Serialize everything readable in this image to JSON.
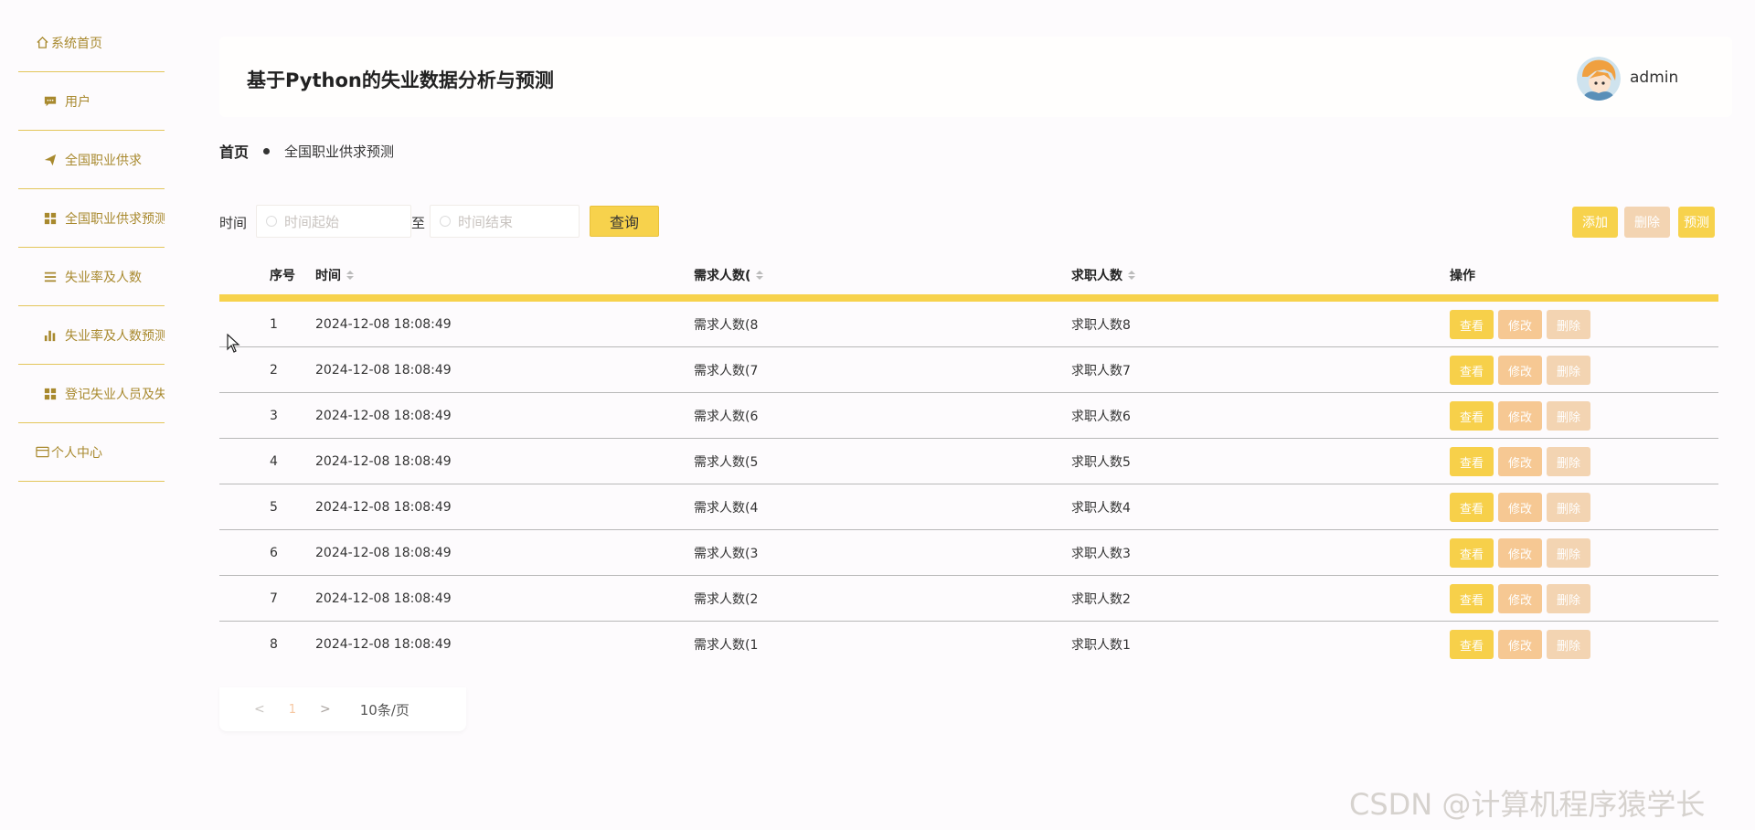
{
  "sidebar": {
    "items": [
      {
        "label": "系统首页",
        "icon": "home-icon"
      },
      {
        "label": "用户",
        "icon": "chat-icon"
      },
      {
        "label": "全国职业供求",
        "icon": "send-icon"
      },
      {
        "label": "全国职业供求预测",
        "icon": "grid-icon"
      },
      {
        "label": "失业率及人数",
        "icon": "list-icon"
      },
      {
        "label": "失业率及人数预测",
        "icon": "bar-chart-icon"
      },
      {
        "label": "登记失业人员及失业率",
        "icon": "grid-icon"
      },
      {
        "label": "个人中心",
        "icon": "card-icon"
      }
    ]
  },
  "header": {
    "title": "基于Python的失业数据分析与预测",
    "user": "admin"
  },
  "breadcrumb": {
    "home": "首页",
    "current": "全国职业供求预测"
  },
  "search": {
    "label": "时间",
    "start_placeholder": "时间起始",
    "to": "至",
    "end_placeholder": "时间结束",
    "query_label": "查询"
  },
  "toolbar": {
    "add_label": "添加",
    "delete_label": "删除",
    "predict_label": "预测"
  },
  "table": {
    "headers": {
      "index": "序号",
      "time": "时间",
      "demand": "需求人数(",
      "seekers": "求职人数",
      "ops": "操作"
    },
    "rows": [
      {
        "index": "1",
        "time": "2024-12-08 18:08:49",
        "demand": "需求人数(8",
        "seekers": "求职人数8"
      },
      {
        "index": "2",
        "time": "2024-12-08 18:08:49",
        "demand": "需求人数(7",
        "seekers": "求职人数7"
      },
      {
        "index": "3",
        "time": "2024-12-08 18:08:49",
        "demand": "需求人数(6",
        "seekers": "求职人数6"
      },
      {
        "index": "4",
        "time": "2024-12-08 18:08:49",
        "demand": "需求人数(5",
        "seekers": "求职人数5"
      },
      {
        "index": "5",
        "time": "2024-12-08 18:08:49",
        "demand": "需求人数(4",
        "seekers": "求职人数4"
      },
      {
        "index": "6",
        "time": "2024-12-08 18:08:49",
        "demand": "需求人数(3",
        "seekers": "求职人数3"
      },
      {
        "index": "7",
        "time": "2024-12-08 18:08:49",
        "demand": "需求人数(2",
        "seekers": "求职人数2"
      },
      {
        "index": "8",
        "time": "2024-12-08 18:08:49",
        "demand": "需求人数(1",
        "seekers": "求职人数1"
      }
    ],
    "ops": {
      "view": "查看",
      "edit": "修改",
      "delete": "删除"
    }
  },
  "pagination": {
    "prev": "<",
    "page": "1",
    "next": ">",
    "page_size": "10条/页"
  },
  "watermark": "CSDN @计算机程序猿学长",
  "colors": {
    "accent": "#f7d24c",
    "sidebar_text": "#a8892e",
    "edit": "#f6c893",
    "delete": "#f3d4b2"
  }
}
